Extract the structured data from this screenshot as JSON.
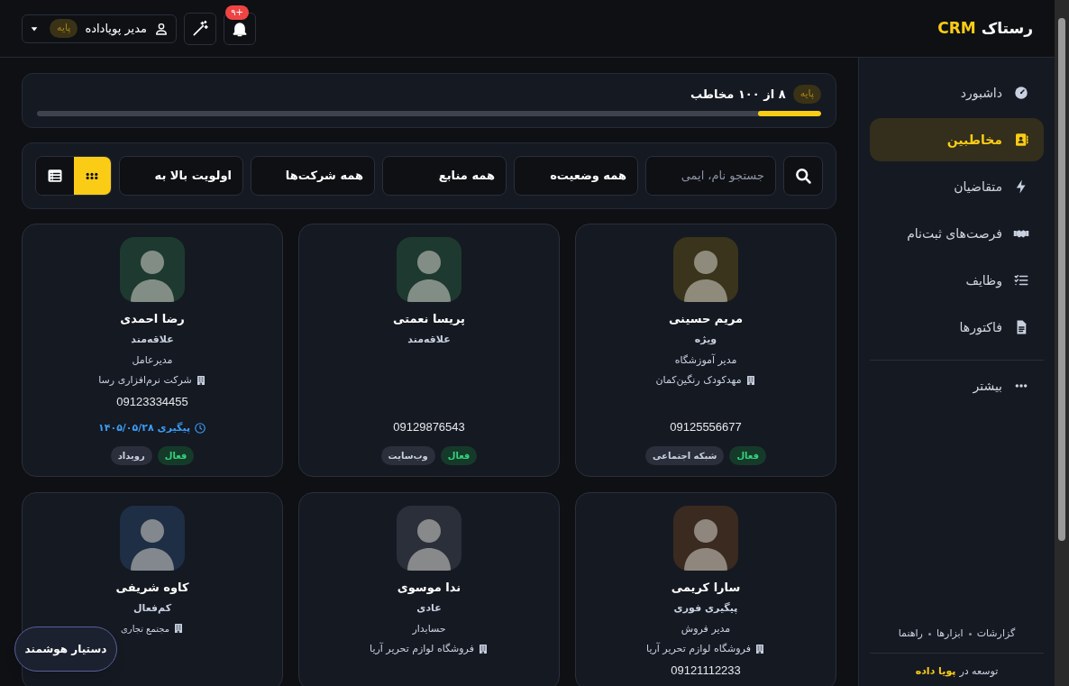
{
  "header": {
    "logo": {
      "name": "رستاک",
      "suffix": "CRM"
    },
    "user": {
      "name": "مدیر پویاداده",
      "plan": "پایه"
    },
    "notifications": {
      "count": "+۹"
    }
  },
  "sidebar": {
    "items": [
      {
        "label": "داشبورد",
        "selected": false
      },
      {
        "label": "مخاطبین",
        "selected": true
      },
      {
        "label": "متقاضیان",
        "selected": false
      },
      {
        "label": "فرصت‌های ثبت‌نام",
        "selected": false
      },
      {
        "label": "وظایف",
        "selected": false
      },
      {
        "label": "فاکتورها",
        "selected": false
      }
    ],
    "more": {
      "label": "بیشتر"
    },
    "footer_links": [
      "گزارشات",
      "ابزارها",
      "راهنما"
    ],
    "credit": {
      "text": "توسعه در",
      "link": "پویا داده"
    }
  },
  "usage": {
    "plan": "پایه",
    "text": "۸ از ۱۰۰ مخاطب",
    "level": 0.08
  },
  "filters": {
    "search": {
      "placeholder": "جستجو نام، ایمی"
    },
    "dropdowns": [
      "همه وضعیت‌ه",
      "همه منابع",
      "همه شرکت‌ها",
      "اولویت بالا به"
    ],
    "views": [
      {
        "selected": true
      },
      {
        "selected": false
      }
    ]
  },
  "contacts": [
    {
      "name": "مریم حسینی",
      "color": "#3a341c",
      "category": "ویژه",
      "job": "مدیر آموزشگاه",
      "company": "مهدکودک رنگین‌کمان",
      "phone": "09125556677",
      "tags": [
        {
          "label": "فعال",
          "kind": "status"
        },
        {
          "label": "شبکه اجتماعی",
          "kind": "source"
        }
      ]
    },
    {
      "name": "پریسا نعمتی",
      "color": "#1e3a30",
      "category": "علاقه‌مند",
      "phone": "09129876543",
      "tags": [
        {
          "label": "فعال",
          "kind": "status"
        },
        {
          "label": "وب‌سایت",
          "kind": "source"
        }
      ]
    },
    {
      "name": "رضا احمدی",
      "color": "#1e3a30",
      "category": "علاقه‌مند",
      "job": "مدیرعامل",
      "company": "شرکت نرم‌افزاری رسا",
      "phone": "09123334455",
      "followup": "پیگیری ۱۴۰۵/۰۵/۲۸",
      "tags": [
        {
          "label": "فعال",
          "kind": "status"
        },
        {
          "label": "رویداد",
          "kind": "source"
        }
      ]
    },
    {
      "name": "سارا کریمی",
      "color": "#3b2a20",
      "category": "پیگیری فوری",
      "job": "مدیر فروش",
      "company": "فروشگاه لوازم تحریر آریا",
      "phone": "09121112233"
    },
    {
      "name": "ندا موسوی",
      "color": "#2a2f3a",
      "category": "عادی",
      "job": "حسابدار",
      "company": "فروشگاه لوازم تحریر آریا"
    },
    {
      "name": "کاوه شریفی",
      "color": "#1e2e44",
      "category": "کم‌فعال",
      "company": "مجتمع تجاری"
    }
  ],
  "assistant": {
    "label": "دستیار هوشمند"
  }
}
